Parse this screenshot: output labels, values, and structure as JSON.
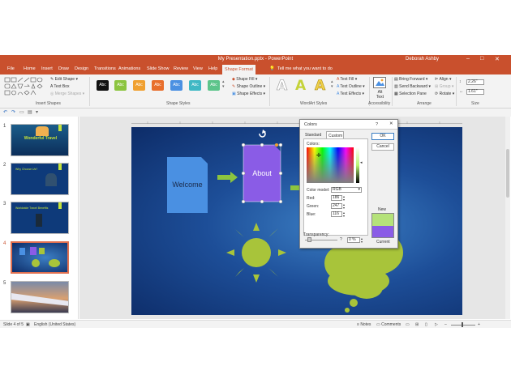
{
  "title_bar": {
    "title": "My Presentation.pptx  -  PowerPoint",
    "user": "Deborah Ashby"
  },
  "tabs": [
    "File",
    "Home",
    "Insert",
    "Draw",
    "Design",
    "Transitions",
    "Animations",
    "Slide Show",
    "Review",
    "View",
    "Help",
    "Shape Format"
  ],
  "tell_me": "Tell me what you want to do",
  "ribbon": {
    "insert_shapes": {
      "edit_shape": "Edit Shape",
      "text_box": "Text Box",
      "merge_shapes": "Merge Shapes",
      "group": "Insert Shapes"
    },
    "shape_styles": {
      "swatch_label": "Abc",
      "shape_fill": "Shape Fill",
      "shape_outline": "Shape Outline",
      "shape_effects": "Shape Effects",
      "group": "Shape Styles"
    },
    "wordart": {
      "text_fill": "Text Fill",
      "text_outline": "Text Outline",
      "text_effects": "Text Effects",
      "group": "WordArt Styles"
    },
    "accessibility": {
      "alt_text": "Alt Text",
      "group": "Accessibility"
    },
    "arrange": {
      "bring_forward": "Bring Forward",
      "send_backward": "Send Backward",
      "selection_pane": "Selection Pane",
      "align": "Align",
      "group_btn": "Group",
      "rotate": "Rotate",
      "group": "Arrange"
    },
    "size": {
      "height": "2.26\"",
      "width": "1.61\"",
      "group": "Size"
    }
  },
  "slides": [
    {
      "n": "1",
      "title": "Wonderful Travel"
    },
    {
      "n": "2",
      "title": "Why Choose Us?"
    },
    {
      "n": "3",
      "title": "Worldwide Travel Benefits"
    },
    {
      "n": "4"
    },
    {
      "n": "5"
    }
  ],
  "slide": {
    "welcome": "Welcome",
    "about": "About"
  },
  "colors": {
    "brand": "#c9502d",
    "slide_bg": "#1d4e98",
    "welcome_fill": "#4a90e2",
    "about_fill": "#8a5ce6",
    "sun": "#a8c43a",
    "arrow": "#8cc43f",
    "new_color": "#b5e27a",
    "current_color": "#8a5ce6"
  },
  "dialog": {
    "title": "Colors",
    "help": "?",
    "close": "✕",
    "tab_standard": "Standard",
    "tab_custom": "Custom",
    "colors_label": "Colors:",
    "color_model_label": "Color model:",
    "color_model": "RGB",
    "red_label": "Red:",
    "red": "186",
    "green_label": "Green:",
    "green": "247",
    "blue_label": "Blue:",
    "blue": "116",
    "transparency_label": "Transparency:",
    "transparency": "0 %",
    "ok": "OK",
    "cancel": "Cancel",
    "new": "New",
    "current": "Current"
  },
  "status": {
    "slide": "Slide 4 of 5",
    "language": "English (United States)",
    "notes": "Notes",
    "comments": "Comments"
  }
}
